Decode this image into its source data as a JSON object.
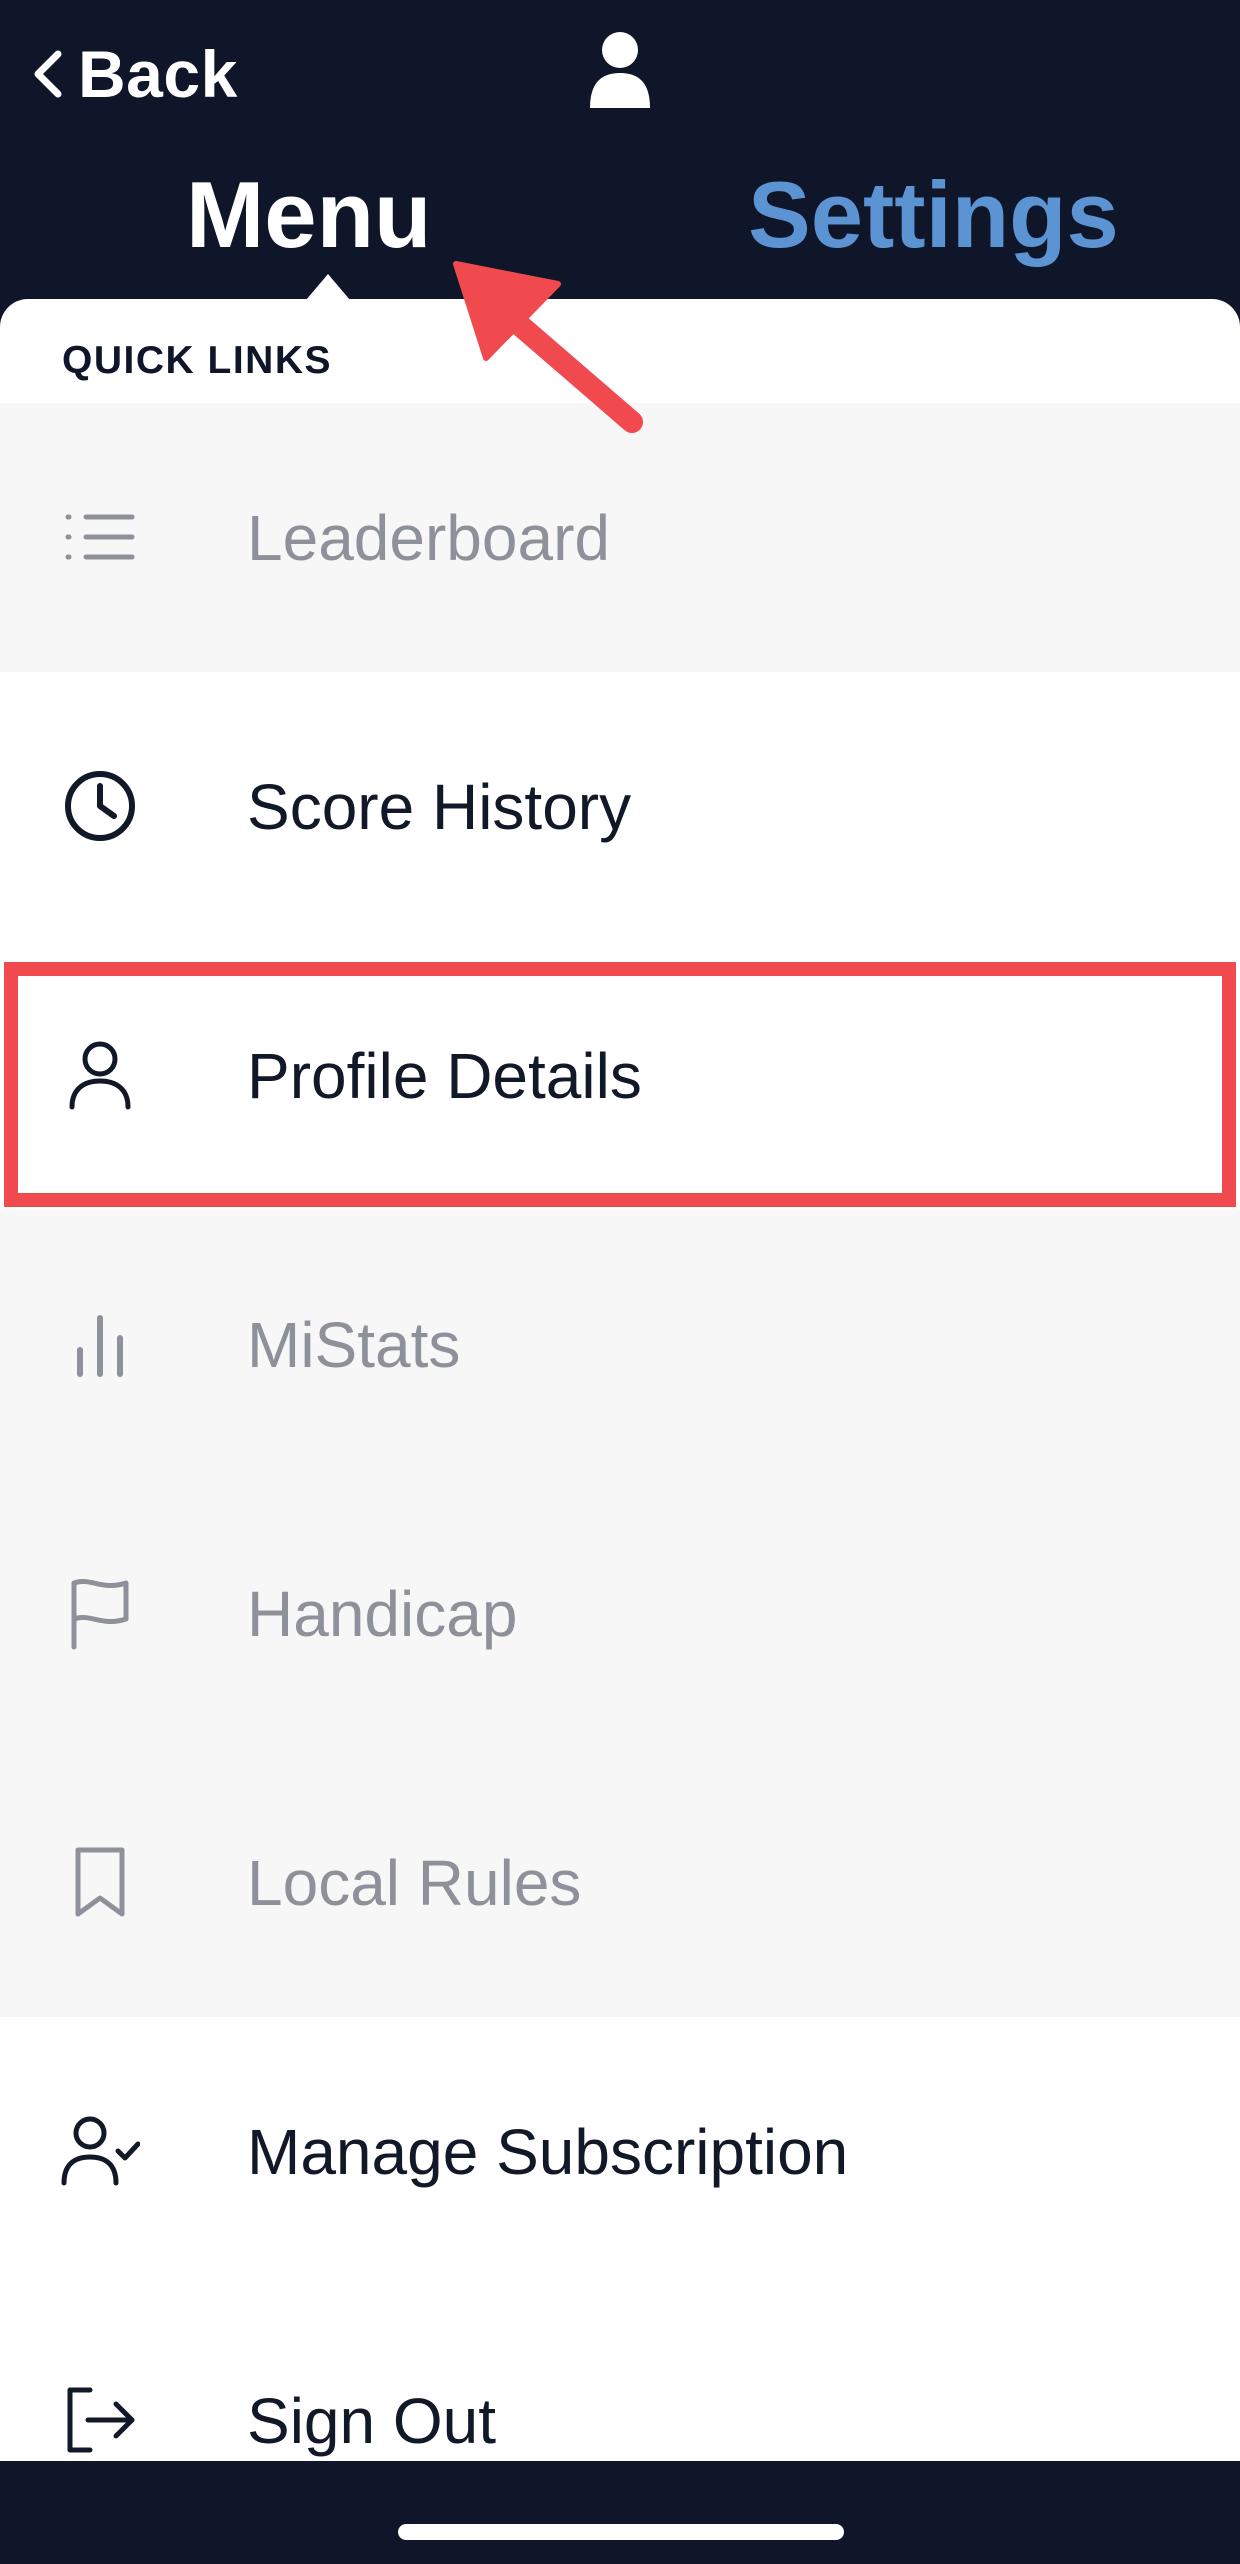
{
  "header": {
    "back_label": "Back",
    "tabs": [
      {
        "label": "Menu",
        "active": true
      },
      {
        "label": "Settings",
        "active": false
      }
    ],
    "colors": {
      "background": "#0f1629",
      "active_tab": "#ffffff",
      "inactive_tab": "#5b93d3"
    }
  },
  "quick_links": {
    "title": "QUICK LINKS",
    "items": [
      {
        "label": "Leaderboard",
        "icon": "list-icon",
        "disabled": true
      },
      {
        "label": "Score History",
        "icon": "clock-icon",
        "disabled": false
      },
      {
        "label": "Profile Details",
        "icon": "user-icon",
        "disabled": false,
        "highlighted": true
      },
      {
        "label": "MiStats",
        "icon": "bar-chart-icon",
        "disabled": true
      },
      {
        "label": "Handicap",
        "icon": "flag-icon",
        "disabled": true
      },
      {
        "label": "Local Rules",
        "icon": "bookmark-icon",
        "disabled": true
      },
      {
        "label": "Manage Subscription",
        "icon": "user-check-icon",
        "disabled": false
      },
      {
        "label": "Sign Out",
        "icon": "log-out-icon",
        "disabled": false
      }
    ]
  },
  "annotation_color": "#f04a4f"
}
